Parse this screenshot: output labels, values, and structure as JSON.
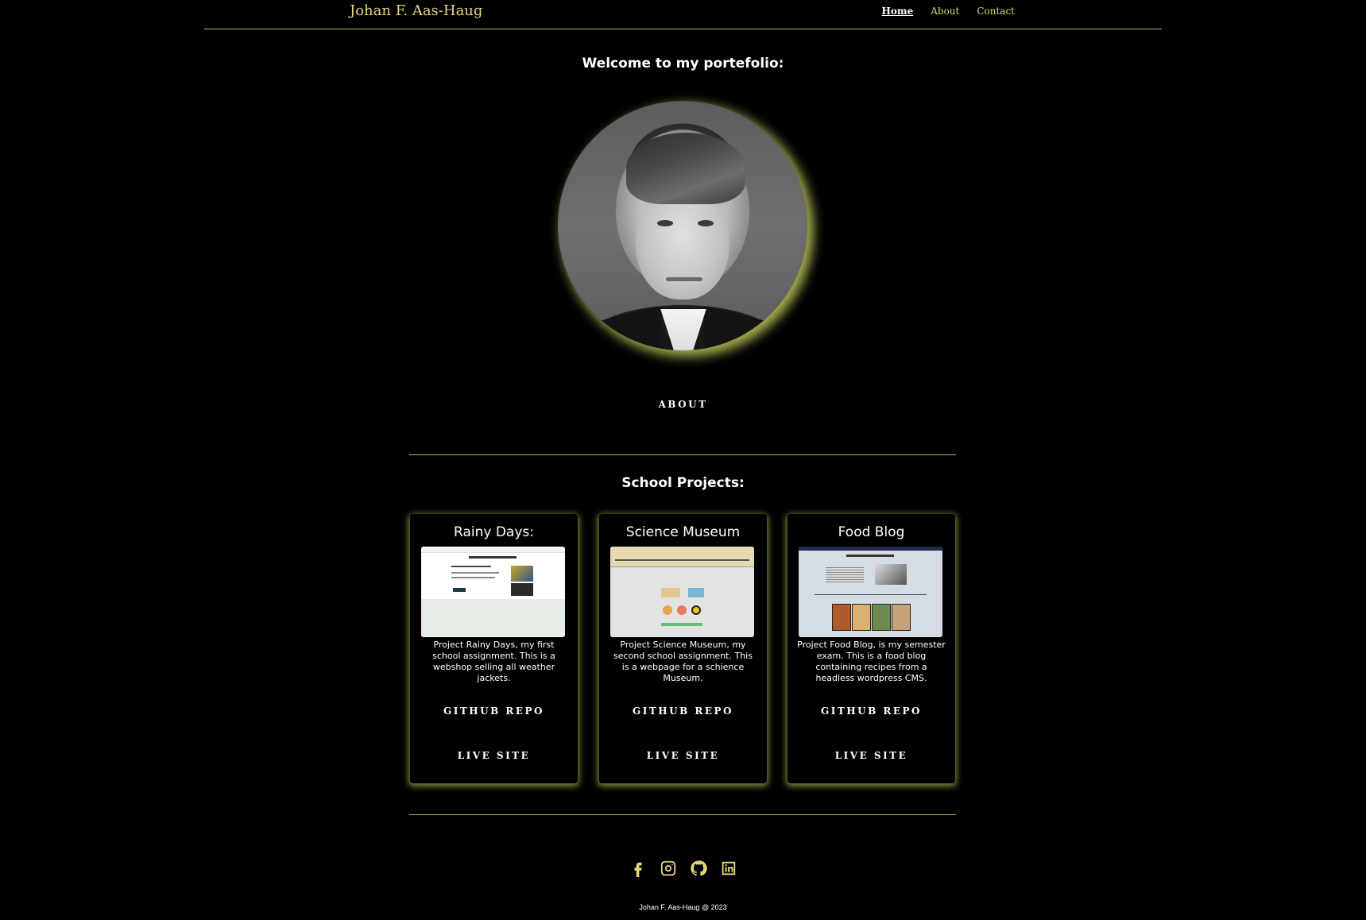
{
  "header": {
    "brand": "Johan F. Aas-Haug",
    "nav": [
      {
        "label": "Home",
        "active": true
      },
      {
        "label": "About",
        "active": false
      },
      {
        "label": "Contact",
        "active": false
      }
    ]
  },
  "hero": {
    "welcome": "Welcome to my portefolio:",
    "about_button": "ABOUT"
  },
  "projects": {
    "title": "School Projects:",
    "items": [
      {
        "title": "Rainy Days:",
        "description": "Project Rainy Days, my first school assignment. This is a webshop selling all weather jackets.",
        "github": "GITHUB REPO",
        "live": "LIVE SITE"
      },
      {
        "title": "Science Museum",
        "description": "Project Science Museum, my second school assignment. This is a webpage for a schience Museum.",
        "github": "GITHUB REPO",
        "live": "LIVE SITE"
      },
      {
        "title": "Food Blog",
        "description": "Project Food Blog, is my semester exam. This is a food blog containing recipes from a headless wordpress CMS.",
        "github": "GITHUB REPO",
        "live": "LIVE SITE"
      }
    ]
  },
  "footer": {
    "socials": [
      "facebook-icon",
      "instagram-icon",
      "github-icon",
      "linkedin-icon"
    ],
    "copyright": "Johan F. Aas-Haug @ 2023"
  },
  "colors": {
    "accent": "#e3d57a",
    "line": "#b9bd63",
    "glow": "#a7ad4f",
    "background": "#000000"
  }
}
